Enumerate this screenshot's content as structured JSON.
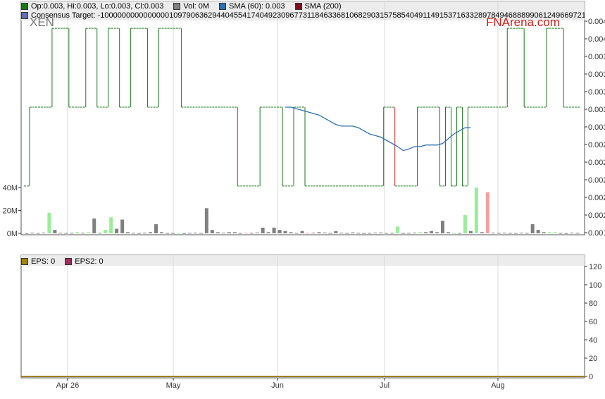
{
  "ticker": "XEN",
  "brand": "FNArena.com",
  "colors": {
    "price": "#1a7a1a",
    "price_down": "#cc2222",
    "sma60": "#2f6fb0",
    "sma200": "#7a1020",
    "vol_up": "#98ee98",
    "vol_down": "#f5a0a0",
    "vol_neutral": "#808080",
    "eps": "#a0860e",
    "eps2": "#a03060",
    "grid": "#d8d8d8",
    "panel_border": "#555555"
  },
  "legend": {
    "price_text": "Op:0.003, Hi:0.003, Lo:0.003, Cl:0.003",
    "vol_text": "Vol: 0M",
    "sma60_text": "SMA (60): 0.003",
    "sma200_text": "SMA (200)",
    "consensus_text": "Consensus Target: -100000000000000010979063629440455417404923096773118463368106829031575854049114915371633289784946888990612496697211772"
  },
  "eps_legend": {
    "eps_text": "EPS: 0",
    "eps2_text": "EPS2: 0"
  },
  "chart_data": [
    {
      "type": "line",
      "title": "",
      "x_labels": [
        "Apr 26",
        "May",
        "Jun",
        "Jul",
        "Aug"
      ],
      "y_tick_labels": [
        "0.001",
        "0.002",
        "0.002",
        "0.002",
        "0.002",
        "0.002",
        "0.003",
        "0.003",
        "0.003",
        "0.003",
        "0.003",
        "0.004",
        "0.004"
      ],
      "y_right_range": [
        0.0014,
        0.0041
      ],
      "series": [
        {
          "name": "Price",
          "values": [
            0.002,
            0.003,
            0.003,
            0.003,
            0.003,
            0.004,
            0.004,
            0.004,
            0.003,
            0.003,
            0.003,
            0.004,
            0.004,
            0.003,
            0.003,
            0.004,
            0.004,
            0.003,
            0.003,
            0.004,
            0.004,
            0.004,
            0.003,
            0.003,
            0.004,
            0.004,
            0.004,
            0.004,
            0.003,
            0.003,
            0.003,
            0.003,
            0.003,
            0.003,
            0.003,
            0.003,
            0.003,
            0.003,
            0.002,
            0.002,
            0.002,
            0.002,
            0.003,
            0.003,
            0.003,
            0.003,
            0.002,
            0.002,
            0.003,
            0.003,
            0.002,
            0.002,
            0.002,
            0.002,
            0.002,
            0.002,
            0.002,
            0.002,
            0.002,
            0.002,
            0.002,
            0.002,
            0.002,
            0.002,
            0.003,
            0.003,
            0.002,
            0.002,
            0.002,
            0.002,
            0.003,
            0.003,
            0.003,
            0.003,
            0.002,
            0.003,
            0.002,
            0.003,
            0.002,
            0.003,
            0.003,
            0.003,
            0.003,
            0.003,
            0.003,
            0.003,
            0.004,
            0.004,
            0.004,
            0.003,
            0.003,
            0.003,
            0.003,
            0.004,
            0.004,
            0.004,
            0.003,
            0.003,
            0.003
          ]
        },
        {
          "name": "SMA (60)",
          "start_index": 46,
          "values": [
            0.003,
            0.003,
            0.00298,
            0.00296,
            0.00294,
            0.00292,
            0.0029,
            0.00286,
            0.00282,
            0.00278,
            0.00276,
            0.00276,
            0.00276,
            0.00274,
            0.0027,
            0.00266,
            0.00264,
            0.00262,
            0.00258,
            0.00254,
            0.0025,
            0.00245,
            0.00247,
            0.0025,
            0.0025,
            0.00252,
            0.00252,
            0.00252,
            0.00254,
            0.0026,
            0.00266,
            0.0027,
            0.00274,
            0.00274
          ]
        }
      ]
    },
    {
      "type": "bar",
      "title": "Volume",
      "y_tick_labels": [
        "0M",
        "20M",
        "40M"
      ],
      "ylim": [
        0,
        45
      ],
      "values": [
        0.2,
        0.5,
        0.3,
        0.6,
        18,
        3,
        0.5,
        0.3,
        0.4,
        1,
        0.5,
        1,
        13,
        0.5,
        3,
        14,
        4,
        12,
        1,
        0.4,
        0.3,
        0.5,
        1,
        8,
        1,
        0.3,
        0.3,
        0.4,
        0.2,
        0.4,
        0.5,
        0.3,
        22,
        3,
        1,
        0.6,
        1,
        1,
        0.3,
        0.5,
        0.4,
        0.7,
        5,
        1,
        5,
        3,
        2,
        1,
        0.3,
        2,
        0.5,
        0.6,
        1,
        0.7,
        0.3,
        2,
        0.5,
        0.3,
        0.8,
        0.4,
        0.2,
        0.3,
        0.6,
        0.7,
        0.3,
        0.4,
        6,
        0.3,
        0.4,
        0.6,
        1,
        1,
        2,
        1,
        11,
        1,
        0.2,
        0.3,
        16,
        2,
        40,
        1,
        36,
        0.6,
        0.4,
        0.5,
        0.3,
        0.3,
        0.5,
        0.4,
        8,
        3,
        1,
        1,
        1,
        0.3,
        0.2,
        0.6,
        0.4
      ],
      "direction": [
        "n",
        "n",
        "n",
        "n",
        "u",
        "n",
        "n",
        "n",
        "n",
        "u",
        "n",
        "u",
        "n",
        "n",
        "u",
        "u",
        "n",
        "n",
        "n",
        "n",
        "n",
        "n",
        "n",
        "n",
        "n",
        "n",
        "n",
        "u",
        "n",
        "n",
        "n",
        "n",
        "n",
        "n",
        "n",
        "n",
        "n",
        "n",
        "n",
        "d",
        "n",
        "n",
        "n",
        "n",
        "n",
        "n",
        "n",
        "n",
        "n",
        "n",
        "d",
        "n",
        "n",
        "n",
        "n",
        "n",
        "n",
        "n",
        "n",
        "n",
        "n",
        "n",
        "n",
        "n",
        "n",
        "n",
        "u",
        "n",
        "n",
        "n",
        "u",
        "n",
        "n",
        "n",
        "n",
        "n",
        "u",
        "n",
        "u",
        "n",
        "u",
        "n",
        "d",
        "n",
        "n",
        "n",
        "n",
        "n",
        "n",
        "n",
        "n",
        "n",
        "n",
        "u",
        "u",
        "n",
        "n",
        "n",
        "n"
      ]
    },
    {
      "type": "line",
      "title": "EPS",
      "y_tick_labels": [
        "0",
        "20",
        "40",
        "60",
        "80",
        "100",
        "120"
      ],
      "ylim": [
        0,
        120
      ],
      "series": [
        {
          "name": "EPS",
          "values": [
            0,
            0
          ]
        },
        {
          "name": "EPS2",
          "values": [
            0,
            0
          ]
        }
      ]
    }
  ]
}
